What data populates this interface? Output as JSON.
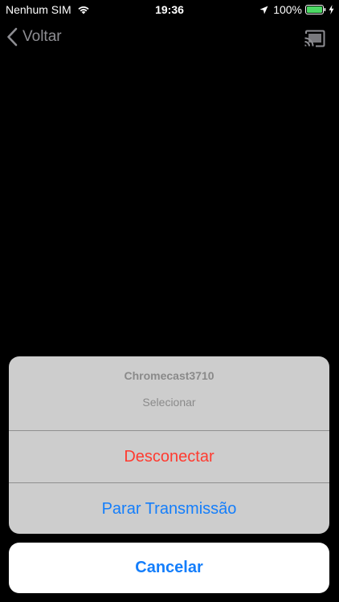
{
  "status_bar": {
    "carrier": "Nenhum SIM",
    "time": "19:36",
    "battery_percent": "100%",
    "icons": [
      "wifi-icon",
      "location-arrow-icon",
      "battery-icon",
      "charging-bolt-icon"
    ]
  },
  "nav": {
    "back_label": "Voltar",
    "cast_icon": "cast-connected-icon"
  },
  "action_sheet": {
    "title": "Chromecast3710",
    "message": "Selecionar",
    "actions": [
      {
        "label": "Desconectar",
        "style": "destructive",
        "color": "#ff3b30"
      },
      {
        "label": "Parar Transmissão",
        "style": "default",
        "color": "#147efb"
      }
    ],
    "cancel_label": "Cancelar"
  }
}
